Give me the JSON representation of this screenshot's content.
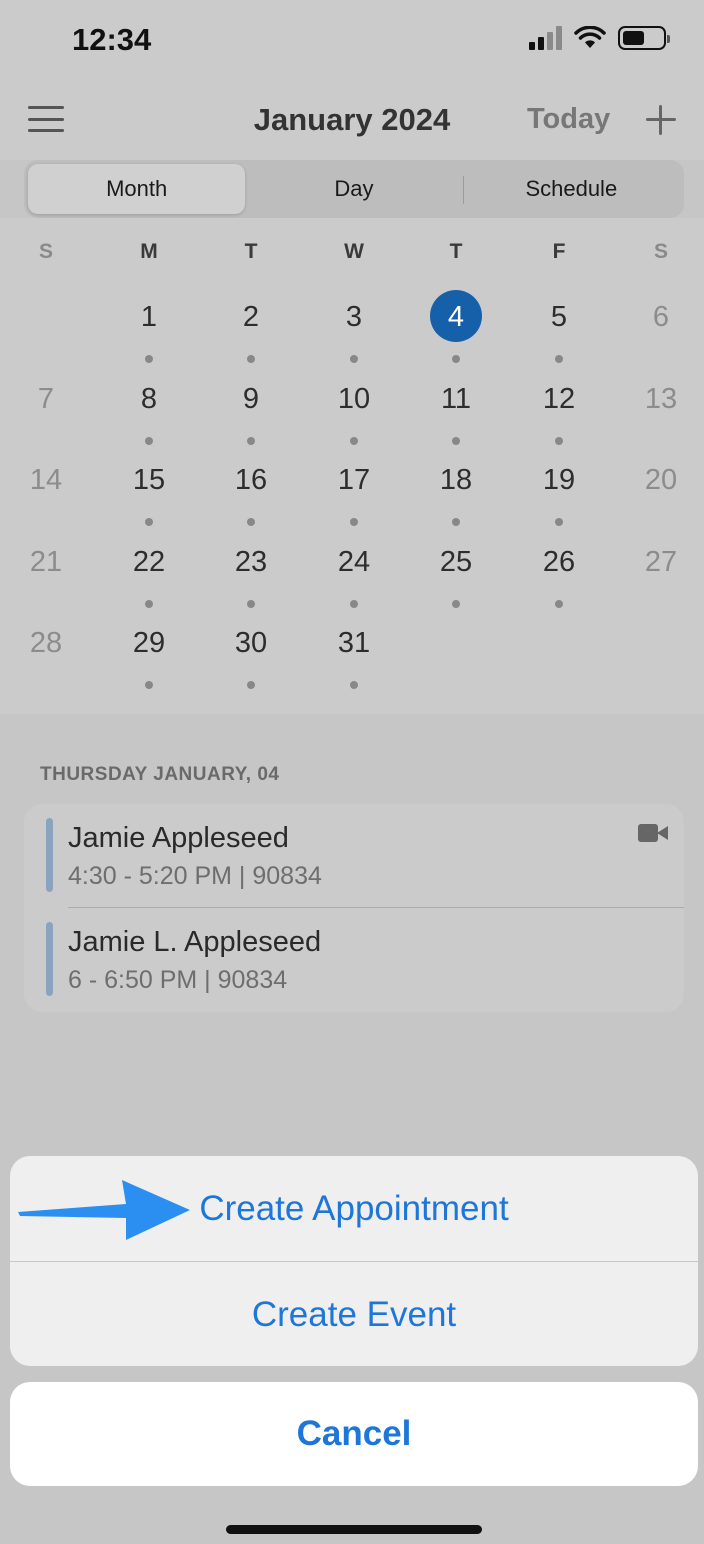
{
  "status_bar": {
    "time": "12:34"
  },
  "header": {
    "title": "January 2024",
    "today_label": "Today"
  },
  "view_tabs": {
    "month": "Month",
    "day": "Day",
    "schedule": "Schedule"
  },
  "calendar": {
    "weekdays": [
      "S",
      "M",
      "T",
      "W",
      "T",
      "F",
      "S"
    ],
    "weeks": [
      [
        null,
        1,
        2,
        3,
        4,
        5,
        6
      ],
      [
        7,
        8,
        9,
        10,
        11,
        12,
        13
      ],
      [
        14,
        15,
        16,
        17,
        18,
        19,
        20
      ],
      [
        21,
        22,
        23,
        24,
        25,
        26,
        27
      ],
      [
        28,
        29,
        30,
        31,
        null,
        null,
        null
      ]
    ],
    "selected_day": 4,
    "days_with_events": [
      1,
      2,
      3,
      4,
      5,
      8,
      9,
      10,
      11,
      12,
      15,
      16,
      17,
      18,
      19,
      22,
      23,
      24,
      25,
      26,
      29,
      30,
      31
    ]
  },
  "agenda": {
    "date_heading": "THURSDAY JANUARY, 04",
    "events": [
      {
        "name": "Jamie Appleseed",
        "details": "4:30 - 5:20 PM  |  90834",
        "icon": "video-camera-icon"
      },
      {
        "name": "Jamie L. Appleseed",
        "details": "6 - 6:50 PM  |  90834",
        "icon": null
      }
    ]
  },
  "action_sheet": {
    "create_appointment": "Create Appointment",
    "create_event": "Create Event",
    "cancel": "Cancel"
  },
  "colors": {
    "accent": "#1e77d8",
    "selected_day": "#1660aa",
    "event_bar": "#8aa4c0",
    "arrow": "#2a8ff0"
  }
}
